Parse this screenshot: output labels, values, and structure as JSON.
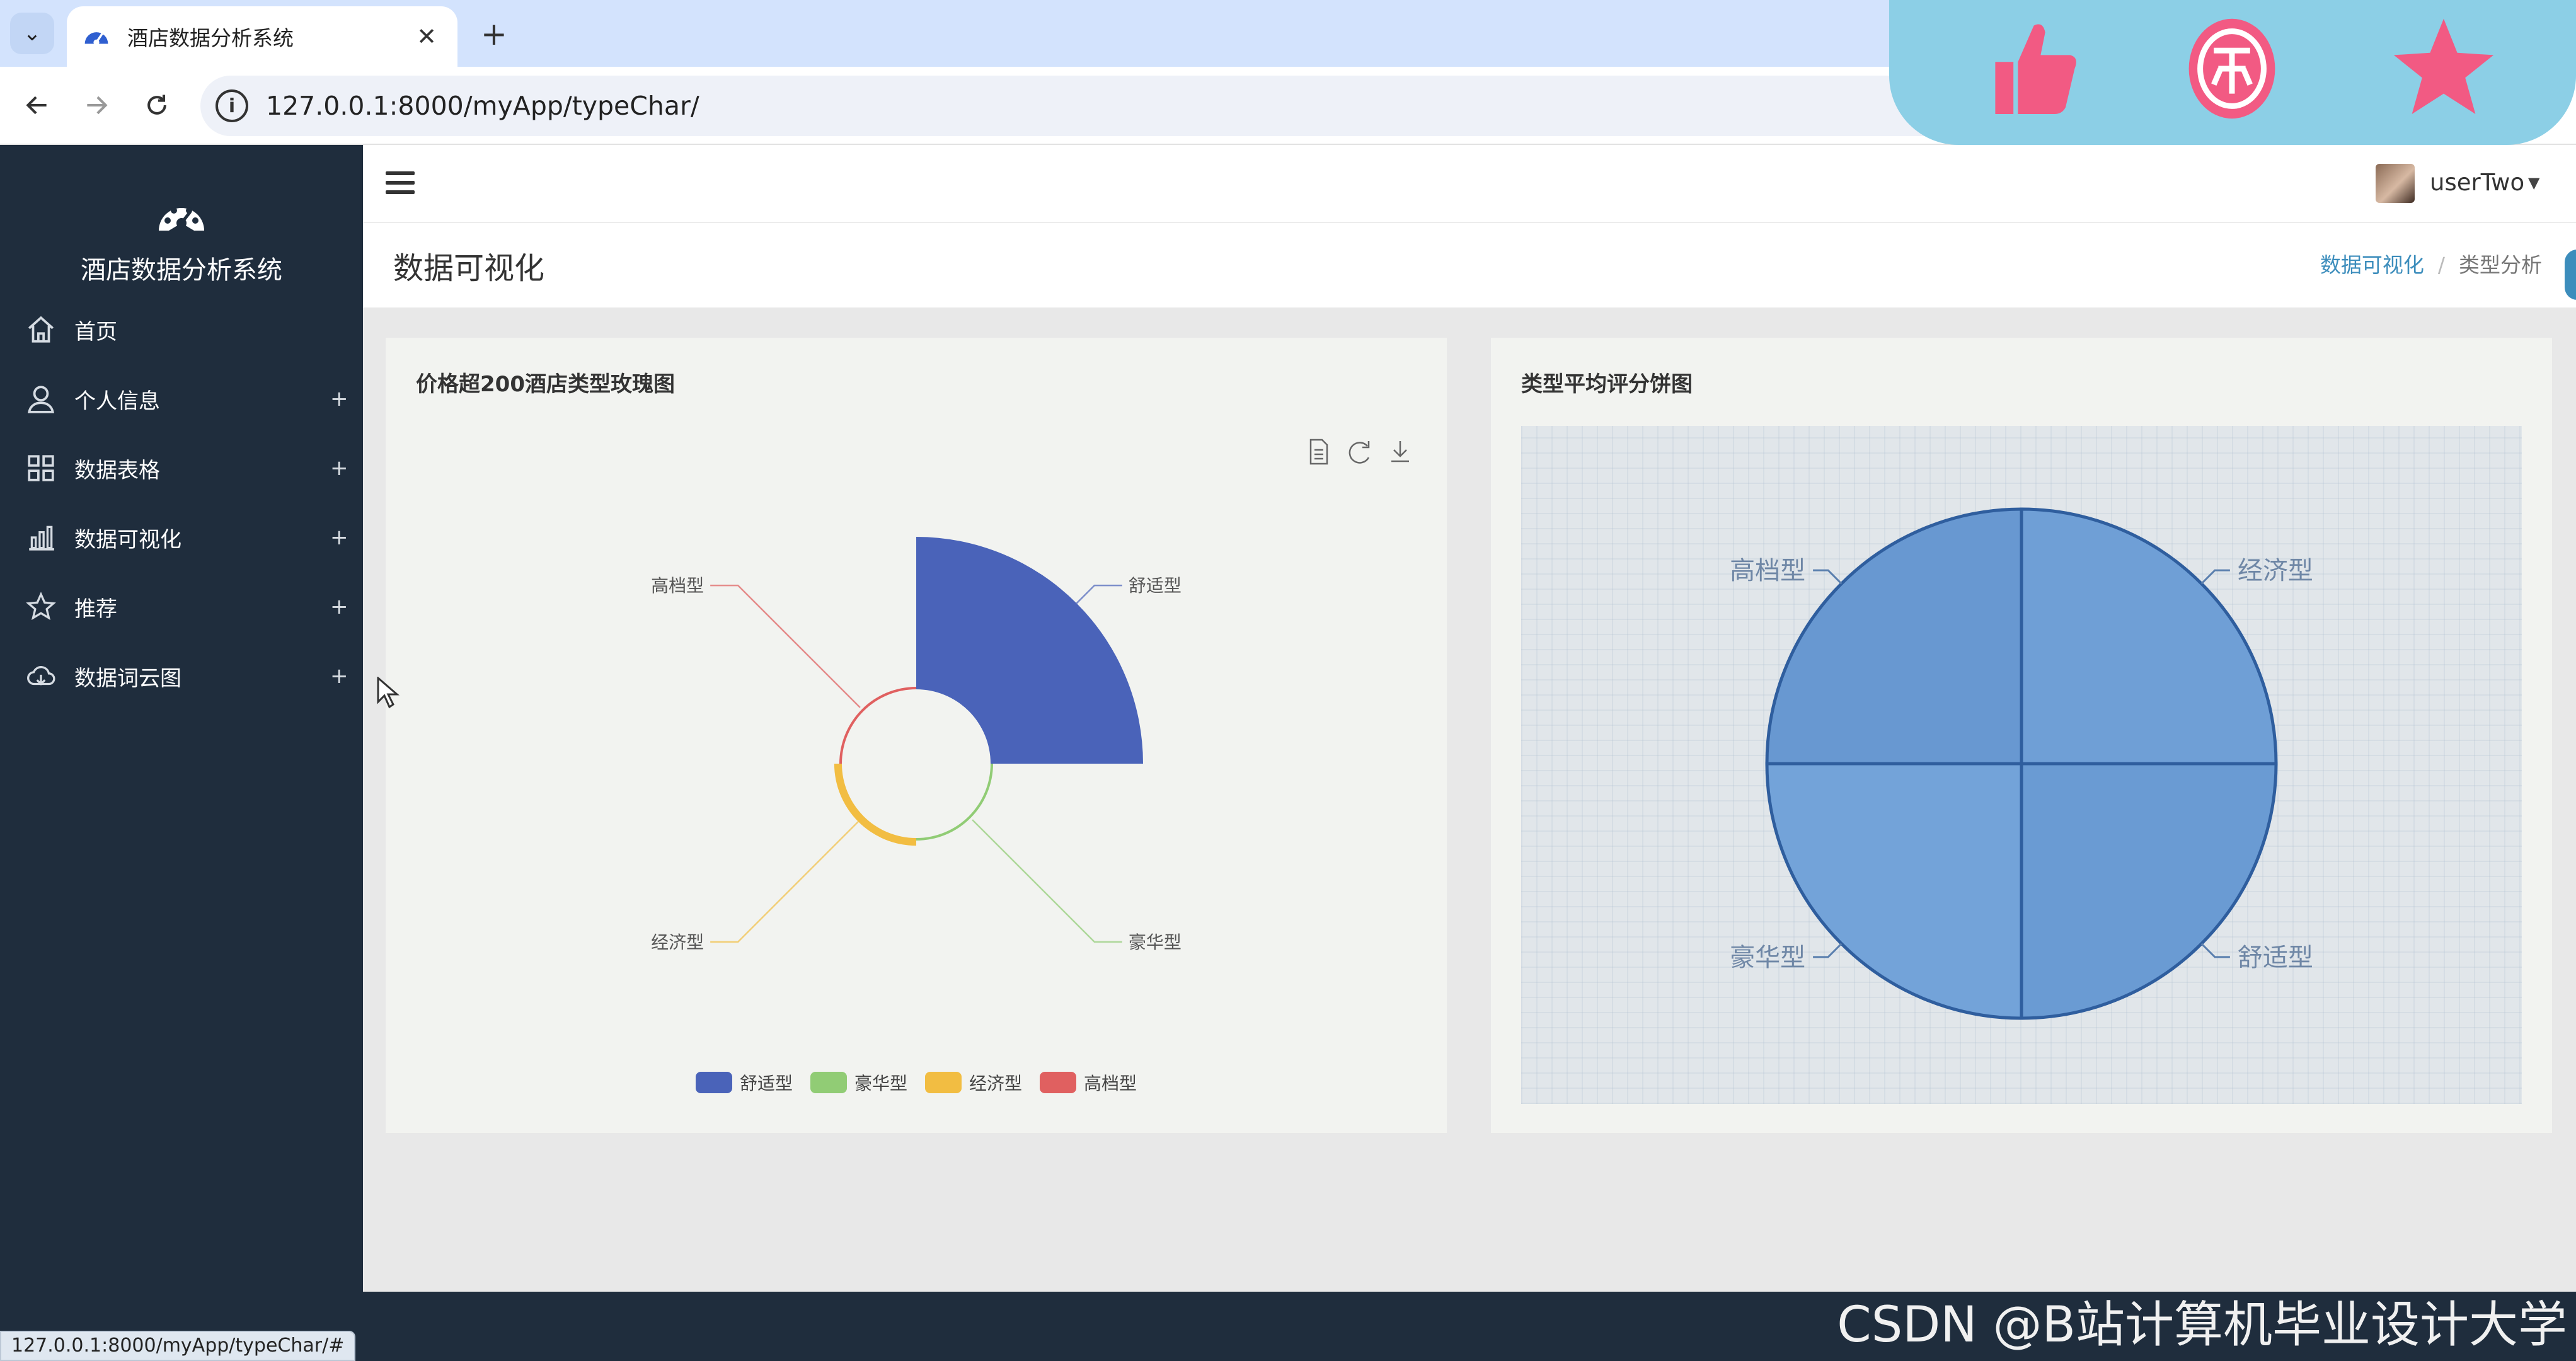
{
  "browser": {
    "tab_title": "酒店数据分析系统",
    "tab_close": "✕",
    "new_tab": "+",
    "url": "127.0.0.1:8000/myApp/typeChar/",
    "status_url": "127.0.0.1:8000/myApp/typeChar/#"
  },
  "sidebar": {
    "brand": "酒店数据分析系统",
    "items": [
      {
        "label": "首页",
        "icon": "home-icon",
        "expandable": false
      },
      {
        "label": "个人信息",
        "icon": "user-icon",
        "expandable": true
      },
      {
        "label": "数据表格",
        "icon": "grid-icon",
        "expandable": true
      },
      {
        "label": "数据可视化",
        "icon": "bar-chart-icon",
        "expandable": true
      },
      {
        "label": "推荐",
        "icon": "star-icon",
        "expandable": true
      },
      {
        "label": "数据词云图",
        "icon": "cloud-icon",
        "expandable": true
      }
    ],
    "plus": "+"
  },
  "header": {
    "username": "userTwo",
    "page_title": "数据可视化",
    "breadcrumb": [
      "数据可视化",
      "类型分析"
    ],
    "breadcrumb_sep": "/"
  },
  "colors": {
    "sidebar": "#1f2d3d",
    "link": "#3c8dbc",
    "series": [
      "#4a63b9",
      "#91cc75",
      "#f2bd42",
      "#e06060"
    ]
  },
  "chart_data": [
    {
      "type": "pie",
      "variant": "rose",
      "title": "价格超200酒店类型玫瑰图",
      "categories": [
        "舒适型",
        "豪华型",
        "经济型",
        "高档型"
      ],
      "values": [
        100,
        1,
        5,
        1
      ],
      "legend": [
        "舒适型",
        "豪华型",
        "经济型",
        "高档型"
      ],
      "legend_position": "bottom",
      "colors": [
        "#4a63b9",
        "#91cc75",
        "#f2bd42",
        "#e06060"
      ],
      "toolbox": [
        "data-view-icon",
        "restore-icon",
        "save-image-icon"
      ]
    },
    {
      "type": "pie",
      "title": "类型平均评分饼图",
      "categories": [
        "经济型",
        "舒适型",
        "豪华型",
        "高档型"
      ],
      "values": [
        4.4,
        4.4,
        4.4,
        4.4
      ],
      "labels": [
        "经济型",
        "舒适型",
        "豪华型",
        "高档型"
      ]
    }
  ],
  "watermark": "CSDN @B站计算机毕业设计大学"
}
